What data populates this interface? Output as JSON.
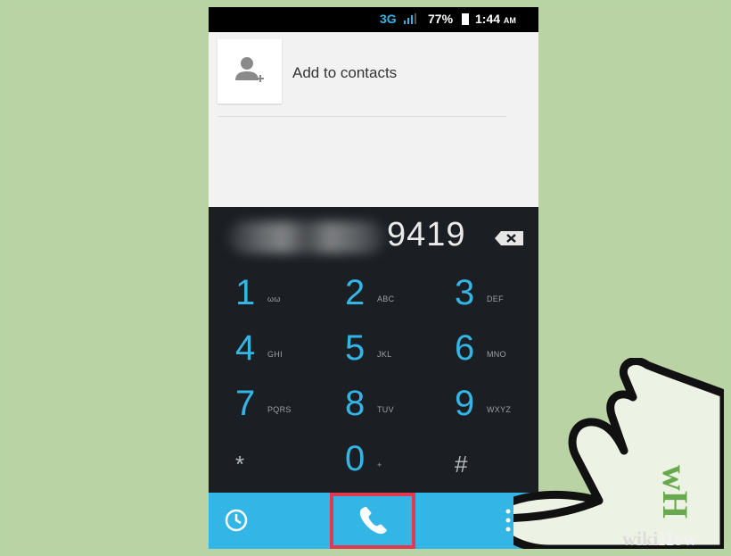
{
  "status_bar": {
    "network": "3G",
    "battery_percent": "77%",
    "time": "1:44",
    "time_suffix": "AM"
  },
  "contacts": {
    "add_label": "Add to contacts",
    "icon": "add-contact-icon"
  },
  "dialer": {
    "visible_digits": "9419",
    "backspace_icon": "backspace-icon"
  },
  "keypad": [
    {
      "num": "1",
      "letters": "ωω"
    },
    {
      "num": "2",
      "letters": "ABC"
    },
    {
      "num": "3",
      "letters": "DEF"
    },
    {
      "num": "4",
      "letters": "GHI"
    },
    {
      "num": "5",
      "letters": "JKL"
    },
    {
      "num": "6",
      "letters": "MNO"
    },
    {
      "num": "7",
      "letters": "PQRS"
    },
    {
      "num": "8",
      "letters": "TUV"
    },
    {
      "num": "9",
      "letters": "WXYZ"
    },
    {
      "num": "*",
      "letters": ""
    },
    {
      "num": "0",
      "letters": "+"
    },
    {
      "num": "#",
      "letters": ""
    }
  ],
  "bottom_bar": {
    "history_icon": "clock-icon",
    "call_icon": "phone-icon",
    "menu_icon": "overflow-menu-icon"
  },
  "overlay": {
    "hand_icon": "pointing-hand-icon",
    "watermark_wiki": "wiki",
    "watermark_how": "How",
    "logo_letters": "wH"
  },
  "colors": {
    "accent": "#33b5e5",
    "background": "#b9d3a5",
    "keypad_bg": "#1b1f23",
    "highlight": "#e03a4e"
  }
}
